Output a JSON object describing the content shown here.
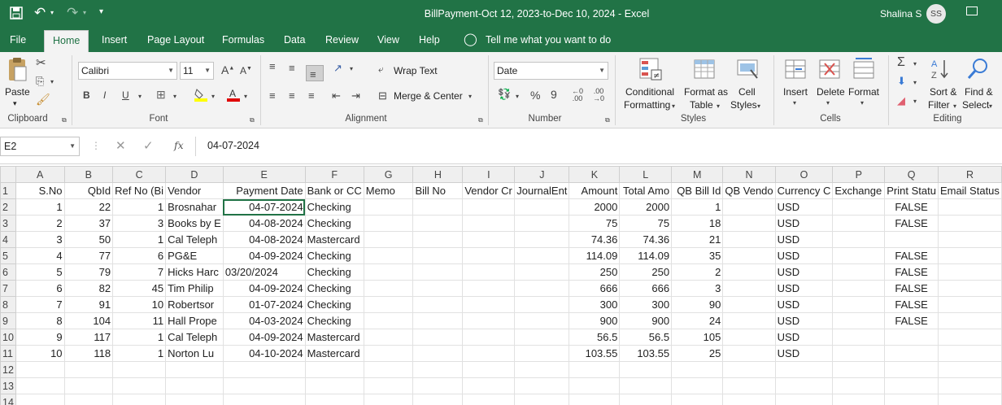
{
  "titlebar": {
    "title": "BillPayment-Oct 12, 2023-to-Dec 10, 2024  -  Excel",
    "user": "Shalina S",
    "avatar": "SS"
  },
  "tabs": [
    "File",
    "Home",
    "Insert",
    "Page Layout",
    "Formulas",
    "Data",
    "Review",
    "View",
    "Help"
  ],
  "tell_me": "Tell me what you want to do",
  "ribbon": {
    "clipboard": {
      "paste": "Paste",
      "label": "Clipboard"
    },
    "font": {
      "name": "Calibri",
      "size": "11",
      "bold": "B",
      "italic": "I",
      "underline": "U",
      "label": "Font"
    },
    "alignment": {
      "wrap": "Wrap Text",
      "merge": "Merge & Center",
      "label": "Alignment"
    },
    "number": {
      "format": "Date",
      "percent": "%",
      "comma": "9",
      "inc": ".00",
      "dec": ".00",
      "label": "Number"
    },
    "styles": {
      "cond1": "Conditional",
      "cond2": "Formatting",
      "fmt1": "Format as",
      "fmt2": "Table",
      "cell1": "Cell",
      "cell2": "Styles",
      "label": "Styles"
    },
    "cells": {
      "insert": "Insert",
      "delete": "Delete",
      "format": "Format",
      "label": "Cells"
    },
    "editing": {
      "sort1": "Sort &",
      "sort2": "Filter",
      "find1": "Find &",
      "find2": "Select",
      "label": "Editing"
    }
  },
  "formula_bar": {
    "name_box": "E2",
    "fx": "fx",
    "value": "04-07-2024"
  },
  "sheet": {
    "columns": [
      "A",
      "B",
      "C",
      "D",
      "E",
      "F",
      "G",
      "H",
      "I",
      "J",
      "K",
      "L",
      "M",
      "N",
      "O",
      "P",
      "Q",
      "R"
    ],
    "headers": [
      "S.No",
      "QbId",
      "Ref No (Bi",
      "Vendor",
      "Payment Date",
      "Bank or CC",
      "Memo",
      "Bill No",
      "Vendor Cr",
      "JournalEnt",
      "Amount",
      "Total Amo",
      "QB Bill Id",
      "QB Vendo",
      "Currency C",
      "Exchange",
      "Print Statu",
      "Email Status"
    ],
    "rows": [
      [
        "1",
        "22",
        "1",
        "Brosnahar",
        "04-07-2024",
        "Checking",
        "",
        "",
        "",
        "",
        "2000",
        "2000",
        "1",
        "",
        "USD",
        "",
        "FALSE",
        ""
      ],
      [
        "2",
        "37",
        "3",
        "Books by E",
        "04-08-2024",
        "Checking",
        "",
        "",
        "",
        "",
        "75",
        "75",
        "18",
        "",
        "USD",
        "",
        "FALSE",
        ""
      ],
      [
        "3",
        "50",
        "1",
        "Cal Teleph",
        "04-08-2024",
        "Mastercard",
        "",
        "",
        "",
        "",
        "74.36",
        "74.36",
        "21",
        "",
        "USD",
        "",
        "",
        ""
      ],
      [
        "4",
        "77",
        "6",
        "PG&E",
        "04-09-2024",
        "Checking",
        "",
        "",
        "",
        "",
        "114.09",
        "114.09",
        "35",
        "",
        "USD",
        "",
        "FALSE",
        ""
      ],
      [
        "5",
        "79",
        "7",
        "Hicks Harc",
        "03/20/2024",
        "Checking",
        "",
        "",
        "",
        "",
        "250",
        "250",
        "2",
        "",
        "USD",
        "",
        "FALSE",
        ""
      ],
      [
        "6",
        "82",
        "45",
        "Tim Philip",
        "04-09-2024",
        "Checking",
        "",
        "",
        "",
        "",
        "666",
        "666",
        "3",
        "",
        "USD",
        "",
        "FALSE",
        ""
      ],
      [
        "7",
        "91",
        "10",
        "Robertsor",
        "01-07-2024",
        "Checking",
        "",
        "",
        "",
        "",
        "300",
        "300",
        "90",
        "",
        "USD",
        "",
        "FALSE",
        ""
      ],
      [
        "8",
        "104",
        "11",
        "Hall Prope",
        "04-03-2024",
        "Checking",
        "",
        "",
        "",
        "",
        "900",
        "900",
        "24",
        "",
        "USD",
        "",
        "FALSE",
        ""
      ],
      [
        "9",
        "117",
        "1",
        "Cal Teleph",
        "04-09-2024",
        "Mastercard",
        "",
        "",
        "",
        "",
        "56.5",
        "56.5",
        "105",
        "",
        "USD",
        "",
        "",
        ""
      ],
      [
        "10",
        "118",
        "1",
        "Norton Lu",
        "04-10-2024",
        "Mastercard",
        "",
        "",
        "",
        "",
        "103.55",
        "103.55",
        "25",
        "",
        "USD",
        "",
        "",
        ""
      ]
    ],
    "blank_rows": [
      "12",
      "13",
      "14"
    ]
  }
}
